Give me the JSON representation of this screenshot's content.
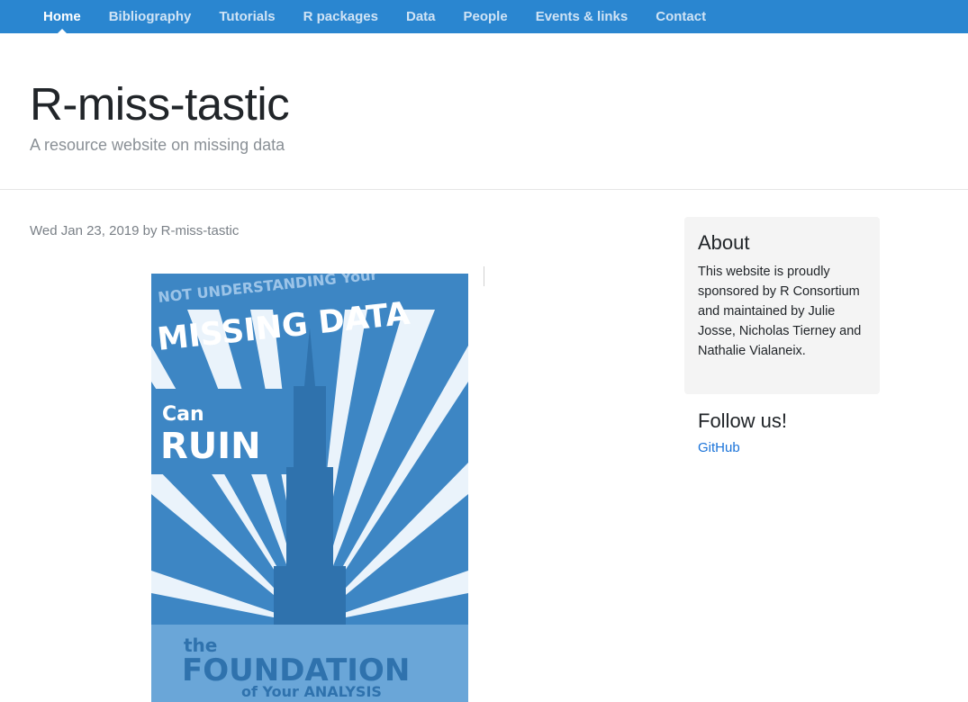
{
  "nav": {
    "items": [
      {
        "label": "Home",
        "active": true
      },
      {
        "label": "Bibliography"
      },
      {
        "label": "Tutorials"
      },
      {
        "label": "R packages"
      },
      {
        "label": "Data"
      },
      {
        "label": "People"
      },
      {
        "label": "Events & links"
      },
      {
        "label": "Contact"
      }
    ]
  },
  "header": {
    "title": "R-miss-tastic",
    "subtitle": "A resource website on missing data"
  },
  "post": {
    "meta": "Wed Jan 23, 2019 by R-miss-tastic",
    "poster": {
      "line1": "NOT UNDERSTANDING Your",
      "line2": "MISSING DATA",
      "line3": "Can",
      "line4": "RUIN",
      "line5": "the",
      "line6": "FOUNDATION",
      "line7": "of Your ANALYSIS"
    }
  },
  "sidebar": {
    "about_title": "About",
    "about_text": "This website is proudly sponsored by R Consortium and maintained by Julie Josse, Nicholas Tierney and Nathalie Vialaneix.",
    "follow_title": "Follow us!",
    "github_label": "GitHub"
  },
  "colors": {
    "navbar": "#2a86d0",
    "poster_blue": "#3d86c4",
    "link": "#1a73d9"
  }
}
